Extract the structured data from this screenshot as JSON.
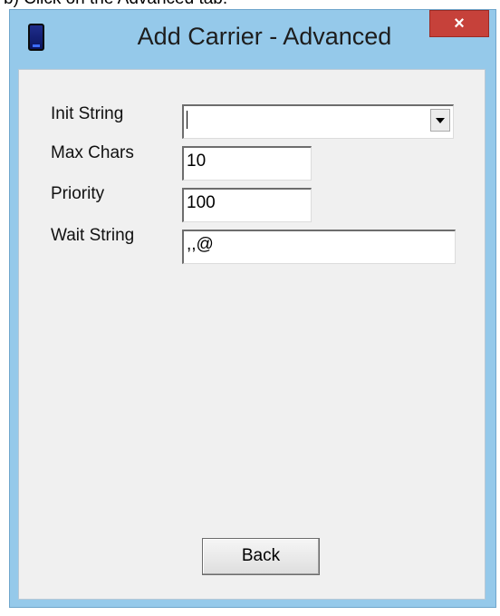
{
  "page_caption": "b) Click on the Advanced tab.",
  "window": {
    "title": "Add Carrier - Advanced",
    "close_symbol": "×",
    "icon": "phone-icon"
  },
  "form": {
    "init_string": {
      "label": "Init String",
      "value": ""
    },
    "max_chars": {
      "label": "Max Chars",
      "value": "10"
    },
    "priority": {
      "label": "Priority",
      "value": "100"
    },
    "wait_string": {
      "label": "Wait String",
      "value": ",,@"
    }
  },
  "buttons": {
    "back": "Back"
  },
  "colors": {
    "title_bar": "#95c9ea",
    "close_button": "#c6413a",
    "dialog_body": "#f0f0f0"
  }
}
